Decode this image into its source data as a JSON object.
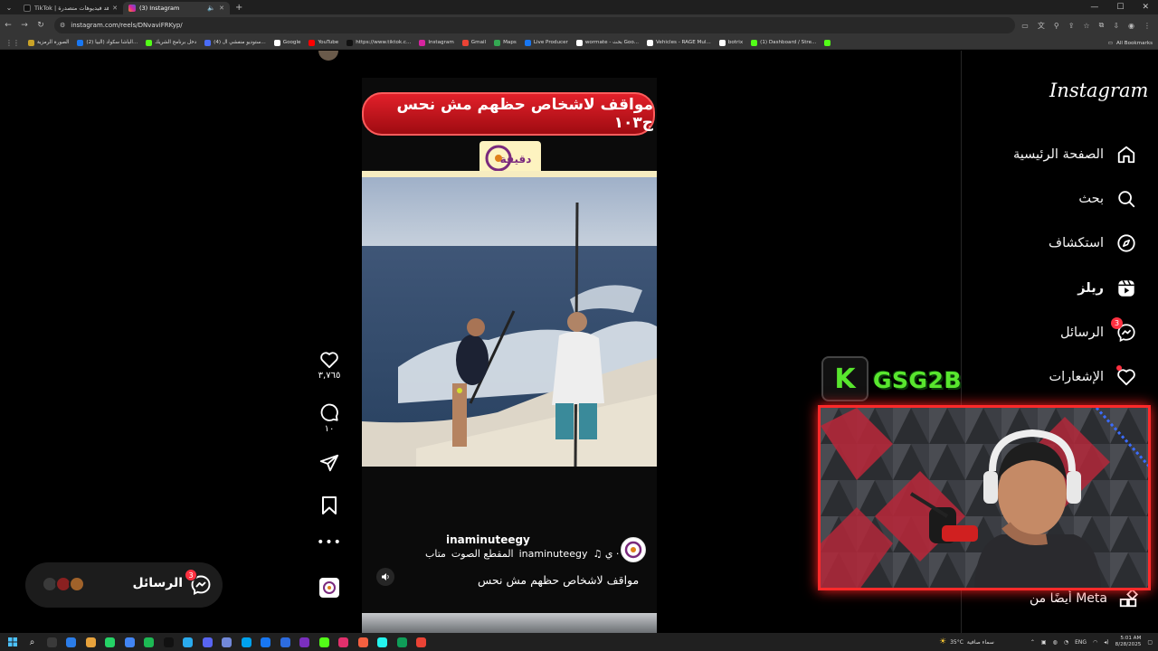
{
  "browser": {
    "tabs": [
      {
        "title": "TikTok | شاهد فيديوهات متصدرة",
        "active": false,
        "favicon_color": "#111111"
      },
      {
        "title": "(3) Instagram",
        "active": true,
        "favicon_color": "#d6249f"
      }
    ],
    "address": "instagram.com/reels/DNvaviFRKyp/",
    "bookmarks": [
      {
        "label": "الصورة الرمزية",
        "icon_color": "#c9a227"
      },
      {
        "label": "(2) الباشا سكواد (البيا...",
        "icon_color": "#1877f2"
      },
      {
        "label": "دخل برنامج الشريك",
        "icon_color": "#53fc18"
      },
      {
        "label": "(4) ستوديو منفشي ال...",
        "icon_color": "#4a6cf7"
      },
      {
        "label": "Google",
        "icon_color": "#ffffff"
      },
      {
        "label": "YouTube",
        "icon_color": "#ff0000"
      },
      {
        "label": "https://www.tiktok.c...",
        "icon_color": "#111111"
      },
      {
        "label": "Instagram",
        "icon_color": "#d6249f"
      },
      {
        "label": "Gmail",
        "icon_color": "#ea4335"
      },
      {
        "label": "Maps",
        "icon_color": "#34a853"
      },
      {
        "label": "Live Producer",
        "icon_color": "#1877f2"
      },
      {
        "label": "wormate - بحث Goo...",
        "icon_color": "#ffffff"
      },
      {
        "label": "Vehicles - RAGE Mul...",
        "icon_color": "#ffffff"
      },
      {
        "label": "botrix",
        "icon_color": "#ffffff"
      },
      {
        "label": "(1) Dashboard / Stre...",
        "icon_color": "#53fc18"
      },
      {
        "label": "",
        "icon_color": "#53fc18"
      }
    ],
    "all_bookmarks": "All Bookmarks"
  },
  "instagram": {
    "logo": "Instagram",
    "nav": [
      {
        "label": "الصفحة الرئيسية",
        "icon": "home-icon"
      },
      {
        "label": "بحث",
        "icon": "search-icon"
      },
      {
        "label": "استكشاف",
        "icon": "explore-icon"
      },
      {
        "label": "ريلز",
        "icon": "reels-icon"
      },
      {
        "label": "الرسائل",
        "icon": "messenger-icon",
        "badge": "3"
      },
      {
        "label": "الإشعارات",
        "icon": "heart-icon",
        "dot": true
      }
    ],
    "also_from_meta": "أيضًا من Meta",
    "messages_pill": {
      "label": "الرسائل",
      "badge": "3"
    }
  },
  "reel": {
    "title_text": "مواقف لاشخاص حظهم مش نحس ج١٠٣",
    "logo_text": "دقيقة",
    "username": "inaminuteegy",
    "audio_line": {
      "artist": "inaminuteegy",
      "track": "المقطع الصوت",
      "follow": "متاب"
    },
    "caption": "مواقف لاشخاص حظهم مش نحس",
    "likes": "٣,٧٦٥",
    "comments": "١٠"
  },
  "stream": {
    "channel": "GSG2B",
    "platform_letter": "K",
    "accent": "#58e62e",
    "frame_color": "#ff2a2a"
  },
  "taskbar": {
    "weather_temp": "35°C",
    "weather_text": "سماء صافية",
    "lang": "ENG",
    "time": "5:01 AM",
    "date": "8/28/2025"
  },
  "colors": {
    "instagram_badge": "#ff3040",
    "background": "#000000"
  }
}
